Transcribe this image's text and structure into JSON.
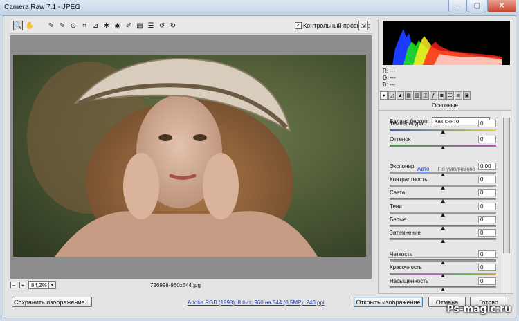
{
  "window": {
    "title": "Camera Raw 7.1  -  JPEG",
    "min": "–",
    "max": "▢",
    "close": "✕"
  },
  "toolbar": {
    "tools": [
      {
        "name": "zoom-tool",
        "glyph": "🔍"
      },
      {
        "name": "hand-tool",
        "glyph": "✋"
      },
      {
        "name": "white-balance-tool",
        "glyph": "✎"
      },
      {
        "name": "color-sampler-tool",
        "glyph": "✎"
      },
      {
        "name": "targeted-adjustment-tool",
        "glyph": "⊙"
      },
      {
        "name": "crop-tool",
        "glyph": "⌗"
      },
      {
        "name": "straighten-tool",
        "glyph": "⊿"
      },
      {
        "name": "spot-removal-tool",
        "glyph": "✱"
      },
      {
        "name": "red-eye-tool",
        "glyph": "◉"
      },
      {
        "name": "adjustment-brush-tool",
        "glyph": "✐"
      },
      {
        "name": "graduated-filter-tool",
        "glyph": "▤"
      },
      {
        "name": "preferences-tool",
        "glyph": "☰"
      },
      {
        "name": "rotate-left-tool",
        "glyph": "↺"
      },
      {
        "name": "rotate-right-tool",
        "glyph": "↻"
      }
    ],
    "preview_label": "Контрольный просмотр",
    "preview_checked": "✓",
    "fullscreen_glyph": "⇲"
  },
  "status": {
    "zoom_minus": "–",
    "zoom_plus": "+",
    "zoom_value": "84,2%",
    "zoom_dd": "▾",
    "filename": "726998-960x544.jpg"
  },
  "bottom": {
    "save_label": "Сохранить изображение...",
    "workflow_link": "Adobe RGB (1998); 8 бит; 960 на 544 (0,5MP); 240 ppi",
    "open_label": "Открыть изображение",
    "cancel_label": "Отмена",
    "done_label": "Готово"
  },
  "histogram": {
    "r_label": "R:  ---",
    "g_label": "G:  ---",
    "b_label": "B:  ---"
  },
  "panel": {
    "title": "Основные",
    "wb_label": "Баланс белого:",
    "wb_value": "Как снято",
    "auto": "Авто",
    "default": "По умолчанию",
    "sliders": [
      {
        "label": "Температура",
        "value": "0",
        "level": 0.5
      },
      {
        "label": "Оттенок",
        "value": "0",
        "level": 0.5
      },
      {
        "label": "Экспонир",
        "value": "0,00",
        "level": 0.5
      },
      {
        "label": "Контрастность",
        "value": "0",
        "level": 0.5
      },
      {
        "label": "Света",
        "value": "0",
        "level": 0.5
      },
      {
        "label": "Тени",
        "value": "0",
        "level": 0.5
      },
      {
        "label": "Белые",
        "value": "0",
        "level": 0.5
      },
      {
        "label": "Затемнение",
        "value": "0",
        "level": 0.5
      },
      {
        "label": "Четкость",
        "value": "0",
        "level": 0.5
      },
      {
        "label": "Красочность",
        "value": "0",
        "level": 0.5
      },
      {
        "label": "Насыщенность",
        "value": "0",
        "level": 0.5
      }
    ]
  },
  "watermark": "Ps-magic.ru"
}
